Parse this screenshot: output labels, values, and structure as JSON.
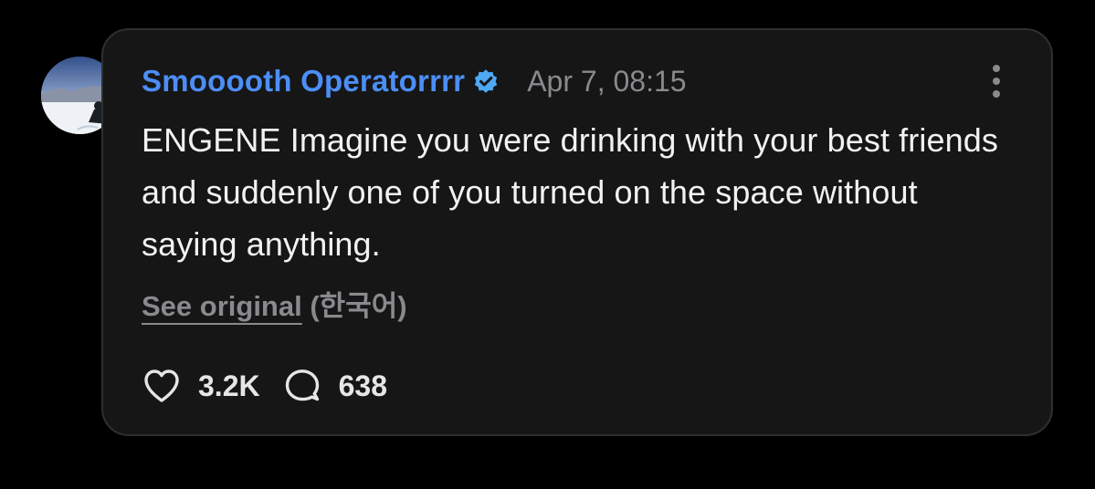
{
  "post": {
    "author_name": "Smooooth Operatorrrr",
    "verified": true,
    "timestamp": "Apr 7, 08:15",
    "text": "ENGENE Imagine you were drinking with your best friends and suddenly one of you turned on the space without saying anything.",
    "translation": {
      "link_label": "See original",
      "language": "(한국어)"
    },
    "stats": {
      "likes": "3.2K",
      "replies": "638"
    }
  },
  "icons": {
    "verified": "verified-badge-icon",
    "more": "more-options-icon",
    "like": "heart-icon",
    "reply": "speech-bubble-icon"
  },
  "colors": {
    "author": "#4c8ef5",
    "verified_badge": "#4ea9f5",
    "card_background": "#161617",
    "page_background": "#000000",
    "muted_text": "#8a8a8e"
  }
}
